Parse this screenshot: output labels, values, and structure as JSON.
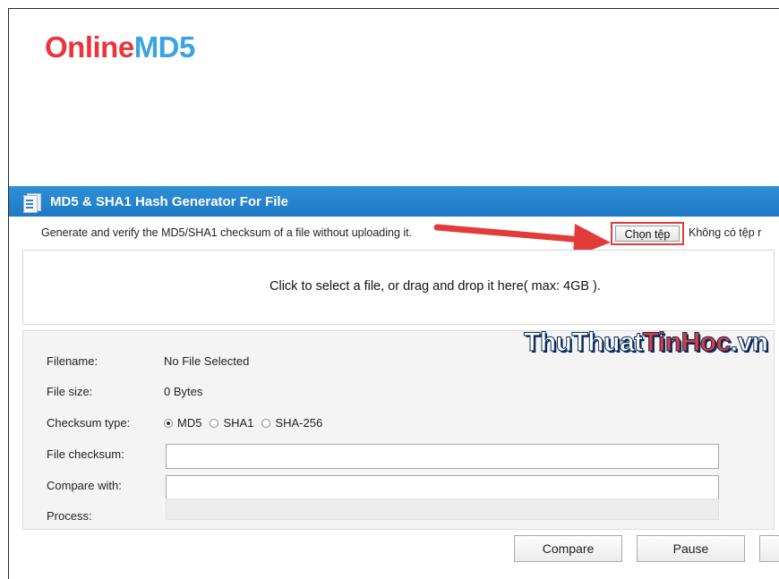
{
  "logo": {
    "part1": "Online",
    "part2": "MD5"
  },
  "panel": {
    "title": "MD5 & SHA1 Hash Generator For File"
  },
  "description": "Generate and verify the MD5/SHA1 checksum of a file without uploading it.",
  "file_input": {
    "button_label": "Chọn tệp",
    "status": "Không có tệp r"
  },
  "dropzone": {
    "text": "Click to select a file, or drag and drop it here( max: 4GB )."
  },
  "form": {
    "filename_label": "Filename:",
    "filename_value": "No File Selected",
    "filesize_label": "File size:",
    "filesize_value": "0 Bytes",
    "checksum_type_label": "Checksum type:",
    "checksum_types": [
      "MD5",
      "SHA1",
      "SHA-256"
    ],
    "checksum_selected": "MD5",
    "file_checksum_label": "File checksum:",
    "compare_with_label": "Compare with:",
    "process_label": "Process:"
  },
  "buttons": {
    "compare": "Compare",
    "pause": "Pause"
  },
  "watermark": {
    "part1": "ThuThuat",
    "part2": "TinHoc",
    "part3": ".vn"
  },
  "colors": {
    "logo_red": "#e8363c",
    "logo_blue": "#3aa3e3",
    "header_blue": "#2f8fd9",
    "highlight_red": "#e23b3b"
  }
}
